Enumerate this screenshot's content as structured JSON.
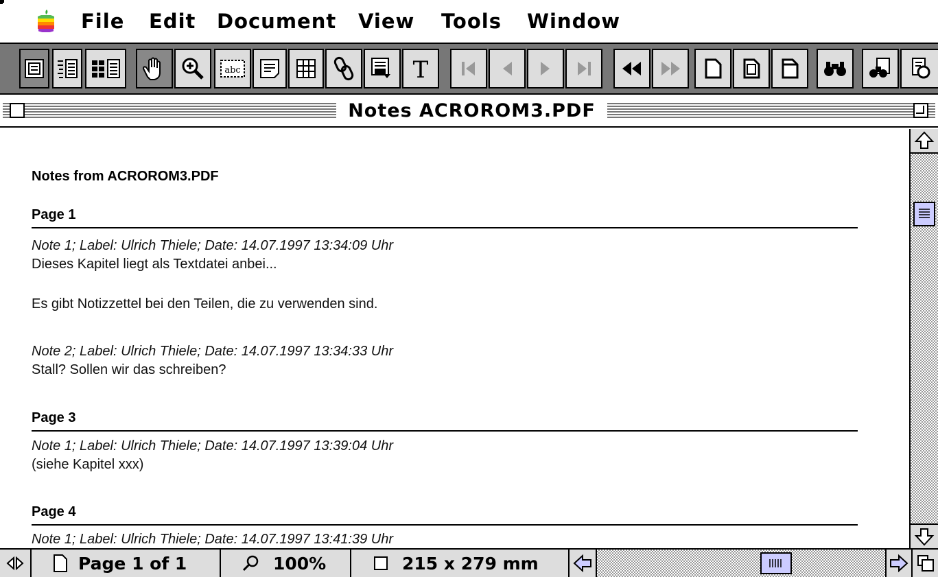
{
  "menubar": {
    "items": [
      "File",
      "Edit",
      "Document",
      "View",
      "Tools",
      "Window"
    ]
  },
  "toolbar": {
    "buttons": [
      "page-only-view-icon",
      "bookmarks-and-page-view-icon",
      "thumbnails-and-page-view-icon",
      "hand-tool-icon",
      "zoom-tool-icon",
      "text-select-tool-icon",
      "note-tool-icon",
      "crop-tool-icon",
      "link-tool-icon",
      "form-tool-icon",
      "touchup-text-tool-icon",
      "first-page-icon",
      "previous-page-icon",
      "next-page-icon",
      "last-page-icon",
      "go-back-icon",
      "go-forward-icon",
      "actual-size-icon",
      "fit-page-icon",
      "fit-width-icon",
      "find-icon",
      "search-icon",
      "search-results-icon"
    ]
  },
  "window": {
    "title": "Notes ACROROM3.PDF"
  },
  "document": {
    "title": "Notes from ACROROM3.PDF",
    "pages": [
      {
        "heading": "Page 1",
        "notes": [
          {
            "meta": "Note 1; Label: Ulrich Thiele; Date: 14.07.1997 13:34:09 Uhr",
            "lines": [
              "Dieses Kapitel liegt als Textdatei anbei...",
              "",
              "Es gibt Notizzettel bei den Teilen, die zu verwenden sind."
            ]
          },
          {
            "meta": "Note 2; Label: Ulrich Thiele; Date: 14.07.1997 13:34:33 Uhr",
            "lines": [
              "Stall? Sollen wir das schreiben?"
            ]
          }
        ]
      },
      {
        "heading": "Page 3",
        "notes": [
          {
            "meta": "Note 1; Label: Ulrich Thiele; Date: 14.07.1997 13:39:04 Uhr",
            "lines": [
              "(siehe Kapitel xxx)"
            ]
          }
        ]
      },
      {
        "heading": "Page 4",
        "notes": [
          {
            "meta": "Note 1; Label: Ulrich Thiele; Date: 14.07.1997 13:41:39 Uhr",
            "lines": []
          }
        ]
      }
    ]
  },
  "statusbar": {
    "page": "Page 1 of 1",
    "zoom": "100%",
    "page_size": "215 x 279 mm"
  },
  "colors": {
    "toolbar_bg": "#777777",
    "button_face": "#dddddd",
    "scroll_thumb": "#ccccff"
  }
}
